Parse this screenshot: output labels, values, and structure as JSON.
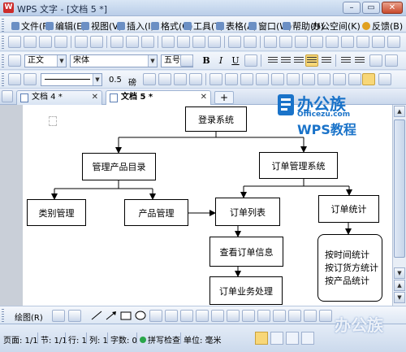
{
  "window": {
    "title": "WPS 文字 - [文档 5 *]",
    "app_icon_letter": "W"
  },
  "menu": {
    "items": [
      "文件(F)",
      "编辑(E)",
      "视图(V)",
      "插入(I)",
      "格式(O)",
      "工具(T)",
      "表格(A)",
      "窗口(W)",
      "帮助(H)",
      "办公空间(K)"
    ],
    "feedback": "反馈(B)"
  },
  "format_toolbar": {
    "style": "正文",
    "font": "宋体",
    "size": "五号",
    "bold": "B",
    "italic": "I",
    "underline": "U"
  },
  "drawing_toolbar": {
    "line_width": "0.5",
    "line_unit": "磅"
  },
  "tabs": [
    {
      "label": "文档 4 *",
      "active": false
    },
    {
      "label": "文档 5 *",
      "active": true
    }
  ],
  "tab_add": "+",
  "flowchart": {
    "nodes": {
      "login": "登录系统",
      "catalog": "管理产品目录",
      "order_mgmt": "订单管理系统",
      "category": "类别管理",
      "product": "产品管理",
      "order_list": "订单列表",
      "order_stats": "订单统计",
      "view_order": "查看订单信息",
      "order_process": "订单业务处理",
      "stats_lines": [
        "按时间统计",
        "按订货方统计",
        "按产品统计"
      ]
    }
  },
  "logo": {
    "line1": "办公族",
    "line2": "Officezu.com",
    "line3": "WPS教程"
  },
  "drawbar": {
    "label": "绘图(R)"
  },
  "status": {
    "page": "页面: 1/1",
    "section": "节: 1/1",
    "row": "行: 1",
    "col": "列: 1",
    "words": "字数: 0",
    "spell": "拼写检查",
    "unit": "单位: 毫米"
  },
  "watermark": "办公族",
  "colors": {
    "accent": "#1a73c9",
    "chrome": "#dbe6f4"
  }
}
